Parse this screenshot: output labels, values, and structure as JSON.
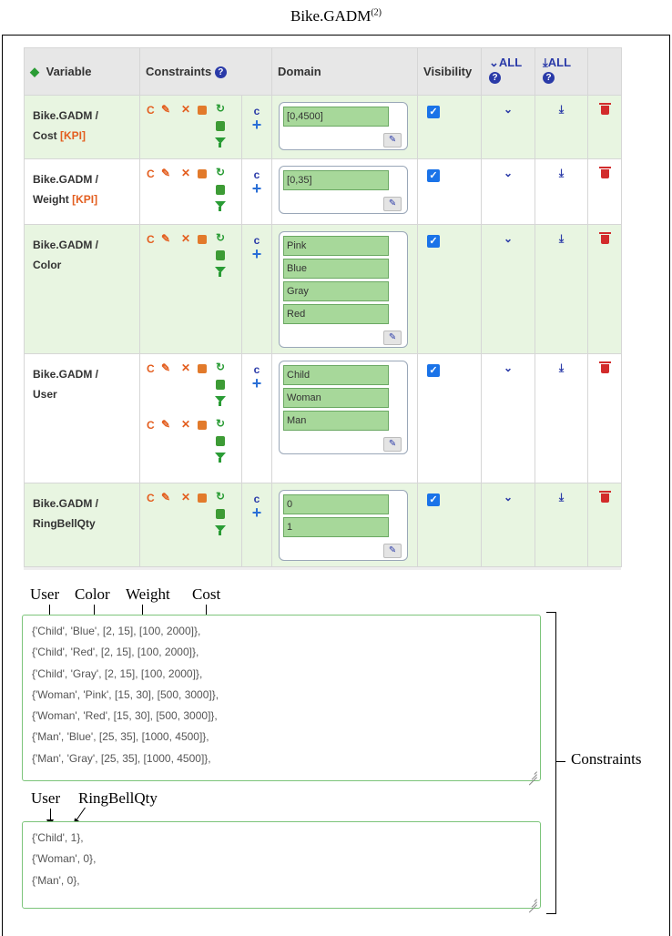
{
  "figure": {
    "title": "Bike.GADM",
    "title_sup": "(2)"
  },
  "table": {
    "headers": {
      "variable": "Variable",
      "constraints": "Constraints",
      "domain": "Domain",
      "visibility": "Visibility",
      "expand_all": "ALL",
      "last_all": "ALL"
    },
    "rows": [
      {
        "name": "Bike.GADM /",
        "name2": "Cost",
        "kpi": "[KPI]",
        "domain": [
          "[0,4500]"
        ],
        "visible": true
      },
      {
        "name": "Bike.GADM /",
        "name2": "Weight",
        "kpi": "[KPI]",
        "domain": [
          "[0,35]"
        ],
        "visible": true
      },
      {
        "name": "Bike.GADM /",
        "name2": "Color",
        "kpi": "",
        "domain": [
          "Pink",
          "Blue",
          "Gray",
          "Red"
        ],
        "visible": true
      },
      {
        "name": "Bike.GADM /",
        "name2": "User",
        "kpi": "",
        "domain": [
          "Child",
          "Woman",
          "Man"
        ],
        "visible": true
      },
      {
        "name": "Bike.GADM /",
        "name2": "RingBellQty",
        "kpi": "",
        "domain": [
          "0",
          "1"
        ],
        "visible": true
      }
    ],
    "icons": {
      "c_letter": "C",
      "add_c": "c",
      "add_plus": "+"
    }
  },
  "constraints_section": {
    "labels1": [
      "User",
      "Color",
      "Weight",
      "Cost"
    ],
    "box1_lines": [
      "{'Child', 'Blue', [2, 15], [100, 2000]},",
      "{'Child', 'Red', [2, 15], [100, 2000]},",
      "{'Child', 'Gray', [2, 15], [100, 2000]},",
      "{'Woman', 'Pink', [15, 30], [500, 3000]},",
      "{'Woman', 'Red', [15, 30], [500, 3000]},",
      "{'Man', 'Blue', [25, 35], [1000, 4500]},",
      "{'Man', 'Gray', [25, 35], [1000, 4500]},"
    ],
    "labels2": [
      "User",
      "RingBellQty"
    ],
    "box2_lines": [
      "{'Child', 1},",
      "{'Woman', 0},",
      "{'Man', 0},"
    ],
    "brace_label": "Constraints"
  },
  "colors": {
    "kpi": "#e35e1f",
    "accent_blue": "#2a3aa8",
    "green": "#2a9c35",
    "row_green": "#e8f5e1",
    "domain_value": "#a7d89a"
  }
}
